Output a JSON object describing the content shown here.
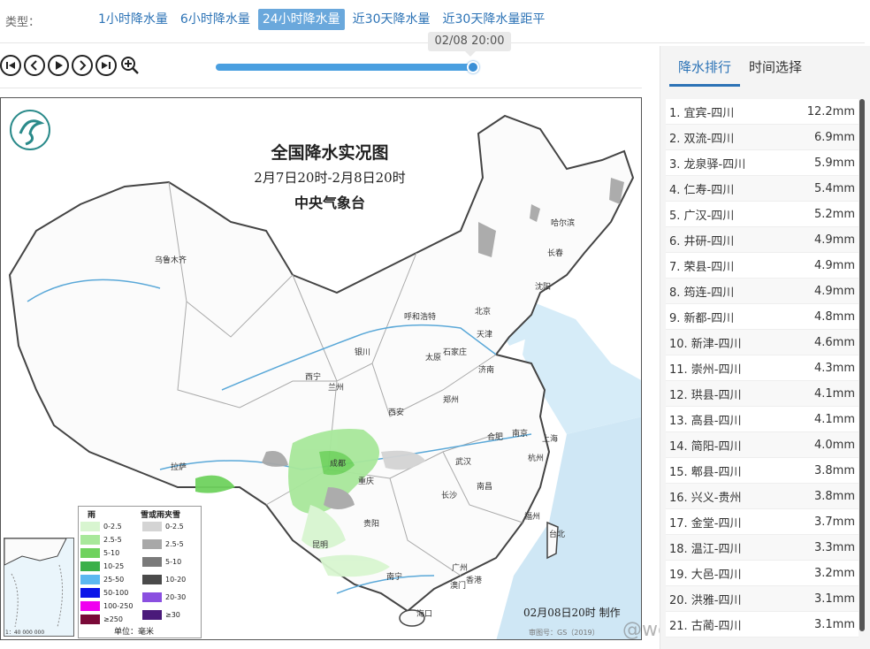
{
  "header": {
    "type_label": "类型：",
    "tabs": [
      {
        "label": "1小时降水量",
        "active": false
      },
      {
        "label": "6小时降水量",
        "active": false
      },
      {
        "label": "24小时降水量",
        "active": true
      },
      {
        "label": "近30天降水量",
        "active": false
      },
      {
        "label": "近30天降水量距平",
        "active": false
      }
    ]
  },
  "player": {
    "tooltip": "02/08 20:00",
    "progress": 1.0,
    "buttons": [
      "skip-to-start-icon",
      "previous-icon",
      "play-icon",
      "next-icon",
      "skip-to-end-icon",
      "zoom-in-icon"
    ]
  },
  "map": {
    "title": "全国降水实况图",
    "date_range": "2月7日20时-2月8日20时",
    "org": "中央气象台",
    "made_at": "02月08日20时 制作",
    "map_number": "审图号：GS（2019）",
    "cities": [
      "乌鲁木齐",
      "哈尔滨",
      "长春",
      "沈阳",
      "北京",
      "天津",
      "呼和浩特",
      "银川",
      "太原",
      "石家庄",
      "济南",
      "西宁",
      "兰州",
      "郑州",
      "西安",
      "合肥",
      "南京",
      "上海",
      "成都",
      "武汉",
      "杭州",
      "拉萨",
      "重庆",
      "长沙",
      "南昌",
      "贵阳",
      "福州",
      "台北",
      "昆明",
      "南宁",
      "广州",
      "香港",
      "澳门",
      "海口"
    ],
    "legend": {
      "rain_title": "雨",
      "snow_title": "雪或雨夹雪",
      "rain": [
        {
          "label": "0-2.5",
          "color": "#d8f5d0"
        },
        {
          "label": "2.5-5",
          "color": "#a8e89b"
        },
        {
          "label": "5-10",
          "color": "#6fd25e"
        },
        {
          "label": "10-25",
          "color": "#3bb04a"
        },
        {
          "label": "25-50",
          "color": "#5cb8f0"
        },
        {
          "label": "50-100",
          "color": "#0a14e8"
        },
        {
          "label": "100-250",
          "color": "#f000f0"
        },
        {
          "label": "≥250",
          "color": "#7a0a38"
        }
      ],
      "snow": [
        {
          "label": "0-2.5",
          "color": "#d4d4d4"
        },
        {
          "label": "2.5-5",
          "color": "#a8a8a8"
        },
        {
          "label": "5-10",
          "color": "#7a7a7a"
        },
        {
          "label": "10-20",
          "color": "#4a4a4a"
        },
        {
          "label": "20-30",
          "color": "#8a4fe0"
        },
        {
          "label": "≥30",
          "color": "#4a1a7a"
        }
      ],
      "unit": "单位：毫米"
    },
    "inset_scale": "1：40 000 000",
    "watermark": "@weatherman_倍欣"
  },
  "panel": {
    "tabs": [
      {
        "label": "降水排行",
        "active": true
      },
      {
        "label": "时间选择",
        "active": false
      }
    ],
    "ranking": [
      {
        "rank": "1.",
        "station": "宜宾-四川",
        "value": "12.2mm"
      },
      {
        "rank": "2.",
        "station": "双流-四川",
        "value": "6.9mm"
      },
      {
        "rank": "3.",
        "station": "龙泉驿-四川",
        "value": "5.9mm"
      },
      {
        "rank": "4.",
        "station": "仁寿-四川",
        "value": "5.4mm"
      },
      {
        "rank": "5.",
        "station": "广汉-四川",
        "value": "5.2mm"
      },
      {
        "rank": "6.",
        "station": "井研-四川",
        "value": "4.9mm"
      },
      {
        "rank": "7.",
        "station": "荣县-四川",
        "value": "4.9mm"
      },
      {
        "rank": "8.",
        "station": "筠连-四川",
        "value": "4.9mm"
      },
      {
        "rank": "9.",
        "station": "新都-四川",
        "value": "4.8mm"
      },
      {
        "rank": "10.",
        "station": "新津-四川",
        "value": "4.6mm"
      },
      {
        "rank": "11.",
        "station": "崇州-四川",
        "value": "4.3mm"
      },
      {
        "rank": "12.",
        "station": "珙县-四川",
        "value": "4.1mm"
      },
      {
        "rank": "13.",
        "station": "高县-四川",
        "value": "4.1mm"
      },
      {
        "rank": "14.",
        "station": "简阳-四川",
        "value": "4.0mm"
      },
      {
        "rank": "15.",
        "station": "郫县-四川",
        "value": "3.8mm"
      },
      {
        "rank": "16.",
        "station": "兴义-贵州",
        "value": "3.8mm"
      },
      {
        "rank": "17.",
        "station": "金堂-四川",
        "value": "3.7mm"
      },
      {
        "rank": "18.",
        "station": "温江-四川",
        "value": "3.3mm"
      },
      {
        "rank": "19.",
        "station": "大邑-四川",
        "value": "3.2mm"
      },
      {
        "rank": "20.",
        "station": "洪雅-四川",
        "value": "3.1mm"
      },
      {
        "rank": "21.",
        "station": "古蔺-四川",
        "value": "3.1mm"
      }
    ]
  }
}
